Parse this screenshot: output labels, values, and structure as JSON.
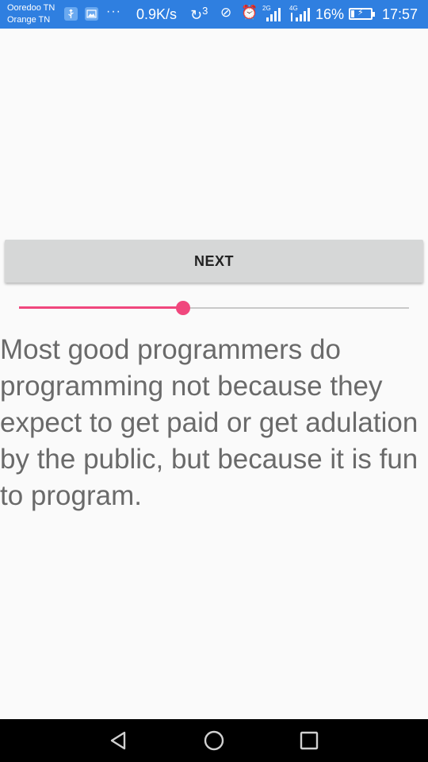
{
  "status_bar": {
    "carrier_1": "Ooredoo TN",
    "carrier_2": "Orange TN",
    "notification_icons": [
      "usb-icon",
      "gallery-icon"
    ],
    "more": "···",
    "net_speed": "0.9K/s",
    "sync_count": "3",
    "network_1": "2G",
    "network_2": "4G",
    "battery_percent": "16%",
    "battery_level": 0.16,
    "time": "17:57",
    "color": "#2f7fe0"
  },
  "main": {
    "next_button_label": "NEXT",
    "slider": {
      "value_fraction": 0.42,
      "accent_color": "#f0477d"
    },
    "quote": "Most good programmers do programming not because they expect to get paid or get adulation by the public, but because it is fun to program."
  },
  "nav_bar": {
    "buttons": [
      "back-icon",
      "home-icon",
      "recents-icon"
    ]
  }
}
